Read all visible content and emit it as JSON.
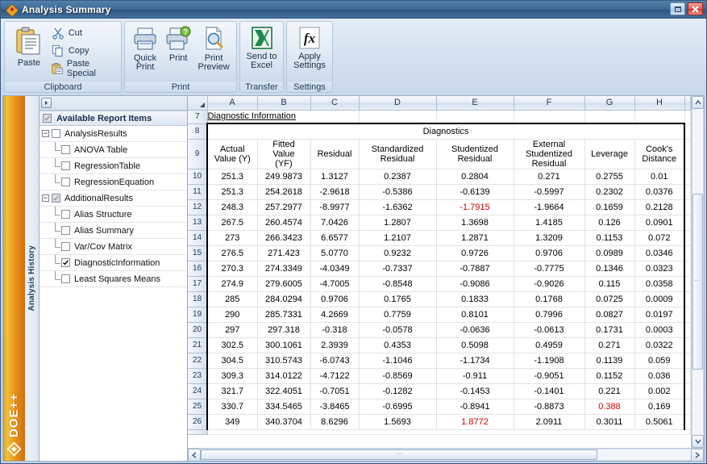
{
  "window": {
    "title": "Analysis Summary",
    "logo_icon": "doe-diamond-icon",
    "buttons": {
      "maximize": "maximize-icon",
      "close": "close-icon"
    }
  },
  "ribbon": {
    "groups": [
      {
        "caption": "Clipboard",
        "big": {
          "label": "Paste",
          "icon": "paste-icon"
        },
        "small": [
          {
            "label": "Cut",
            "icon": "scissors-icon"
          },
          {
            "label": "Copy",
            "icon": "copy-icon"
          },
          {
            "label": "Paste Special",
            "icon": "paste-special-icon"
          }
        ]
      },
      {
        "caption": "Print",
        "items": [
          {
            "label_line1": "Quick",
            "label_line2": "Print",
            "icon": "quick-print-icon"
          },
          {
            "label_line1": "Print",
            "label_line2": "",
            "icon": "print-icon"
          },
          {
            "label_line1": "Print",
            "label_line2": "Preview",
            "icon": "print-preview-icon"
          }
        ]
      },
      {
        "caption": "Transfer",
        "items": [
          {
            "label_line1": "Send to",
            "label_line2": "Excel",
            "icon": "excel-icon"
          }
        ]
      },
      {
        "caption": "Settings",
        "items": [
          {
            "label_line1": "Apply",
            "label_line2": "Settings",
            "icon": "fx-icon"
          }
        ]
      }
    ]
  },
  "brand": {
    "name": "DOE++",
    "logo_icon": "doe-diamond-icon"
  },
  "history_panel": {
    "label": "Analysis History",
    "expand_icon": "chevron-right-icon"
  },
  "tree": {
    "header": {
      "label": "Available Report Items",
      "checkbox": "indeterminate"
    },
    "items": [
      {
        "label": "AnalysisResults",
        "level": 0,
        "checkbox": "unchecked",
        "toggle": "minus"
      },
      {
        "label": "ANOVA Table",
        "level": 1,
        "checkbox": "unchecked",
        "toggle": "none"
      },
      {
        "label": "RegressionTable",
        "level": 1,
        "checkbox": "unchecked",
        "toggle": "none"
      },
      {
        "label": "RegressionEquation",
        "level": 1,
        "checkbox": "unchecked",
        "toggle": "none"
      },
      {
        "label": "AdditionalResults",
        "level": 0,
        "checkbox": "indeterminate",
        "toggle": "minus"
      },
      {
        "label": "Alias Structure",
        "level": 1,
        "checkbox": "unchecked",
        "toggle": "none"
      },
      {
        "label": "Alias Summary",
        "level": 1,
        "checkbox": "unchecked",
        "toggle": "none"
      },
      {
        "label": "Var/Cov Matrix",
        "level": 1,
        "checkbox": "unchecked",
        "toggle": "none"
      },
      {
        "label": "DiagnosticInformation",
        "level": 1,
        "checkbox": "checked",
        "toggle": "none"
      },
      {
        "label": "Least Squares Means",
        "level": 1,
        "checkbox": "unchecked",
        "toggle": "none"
      }
    ]
  },
  "sheet": {
    "column_letters": [
      "A",
      "B",
      "C",
      "D",
      "E",
      "F",
      "G",
      "H"
    ],
    "row_numbers": [
      "7",
      "8",
      "9",
      "10",
      "11",
      "12",
      "13",
      "14",
      "15",
      "16",
      "17",
      "18",
      "19",
      "20",
      "21",
      "22",
      "23",
      "24",
      "25",
      "26"
    ],
    "link_cell": "Diagnostic Information",
    "table_title": "Diagnostics",
    "headers": [
      "Actual\nValue (Y)",
      "Fitted\nValue\n(YF)",
      "Residual",
      "Standardized\nResidual",
      "Studentized\nResidual",
      "External\nStudentized\nResidual",
      "Leverage",
      "Cook's\nDistance"
    ],
    "highlight_color": "#d40000",
    "rows": [
      {
        "row": "10",
        "values": [
          "251.3",
          "249.9873",
          "1.3127",
          "0.2387",
          "0.2804",
          "0.271",
          "0.2755",
          "0.01"
        ]
      },
      {
        "row": "11",
        "values": [
          "251.3",
          "254.2618",
          "-2.9618",
          "-0.5386",
          "-0.6139",
          "-0.5997",
          "0.2302",
          "0.0376"
        ]
      },
      {
        "row": "12",
        "values": [
          "248.3",
          "257.2977",
          "-8.9977",
          "-1.6362",
          "-1.7915",
          "-1.9664",
          "0.1659",
          "0.2128"
        ],
        "highlight": [
          4
        ]
      },
      {
        "row": "13",
        "values": [
          "267.5",
          "260.4574",
          "7.0426",
          "1.2807",
          "1.3698",
          "1.4185",
          "0.126",
          "0.0901"
        ]
      },
      {
        "row": "14",
        "values": [
          "273",
          "266.3423",
          "6.6577",
          "1.2107",
          "1.2871",
          "1.3209",
          "0.1153",
          "0.072"
        ]
      },
      {
        "row": "15",
        "values": [
          "276.5",
          "271.423",
          "5.0770",
          "0.9232",
          "0.9726",
          "0.9706",
          "0.0989",
          "0.0346"
        ]
      },
      {
        "row": "16",
        "values": [
          "270.3",
          "274.3349",
          "-4.0349",
          "-0.7337",
          "-0.7887",
          "-0.7775",
          "0.1346",
          "0.0323"
        ]
      },
      {
        "row": "17",
        "values": [
          "274.9",
          "279.6005",
          "-4.7005",
          "-0.8548",
          "-0.9086",
          "-0.9026",
          "0.115",
          "0.0358"
        ]
      },
      {
        "row": "18",
        "values": [
          "285",
          "284.0294",
          "0.9706",
          "0.1765",
          "0.1833",
          "0.1768",
          "0.0725",
          "0.0009"
        ]
      },
      {
        "row": "19",
        "values": [
          "290",
          "285.7331",
          "4.2669",
          "0.7759",
          "0.8101",
          "0.7996",
          "0.0827",
          "0.0197"
        ]
      },
      {
        "row": "20",
        "values": [
          "297",
          "297.318",
          "-0.318",
          "-0.0578",
          "-0.0636",
          "-0.0613",
          "0.1731",
          "0.0003"
        ]
      },
      {
        "row": "21",
        "values": [
          "302.5",
          "300.1061",
          "2.3939",
          "0.4353",
          "0.5098",
          "0.4959",
          "0.271",
          "0.0322"
        ]
      },
      {
        "row": "22",
        "values": [
          "304.5",
          "310.5743",
          "-6.0743",
          "-1.1046",
          "-1.1734",
          "-1.1908",
          "0.1139",
          "0.059"
        ]
      },
      {
        "row": "23",
        "values": [
          "309.3",
          "314.0122",
          "-4.7122",
          "-0.8569",
          "-0.911",
          "-0.9051",
          "0.1152",
          "0.036"
        ]
      },
      {
        "row": "24",
        "values": [
          "321.7",
          "322.4051",
          "-0.7051",
          "-0.1282",
          "-0.1453",
          "-0.1401",
          "0.221",
          "0.002"
        ]
      },
      {
        "row": "25",
        "values": [
          "330.7",
          "334.5465",
          "-3.8465",
          "-0.6995",
          "-0.8941",
          "-0.8873",
          "0.388",
          "0.169"
        ],
        "highlight": [
          6
        ]
      },
      {
        "row": "26",
        "values": [
          "349",
          "340.3704",
          "8.6296",
          "1.5693",
          "1.8772",
          "2.0911",
          "0.3011",
          "0.5061"
        ],
        "highlight": [
          4
        ]
      }
    ]
  },
  "scrollbars": {
    "vertical": {
      "up_icon": "chevron-up-icon",
      "down_icon": "chevron-down-icon"
    },
    "horizontal": {
      "left_icon": "chevron-left-icon",
      "right_icon": "chevron-right-icon"
    }
  }
}
